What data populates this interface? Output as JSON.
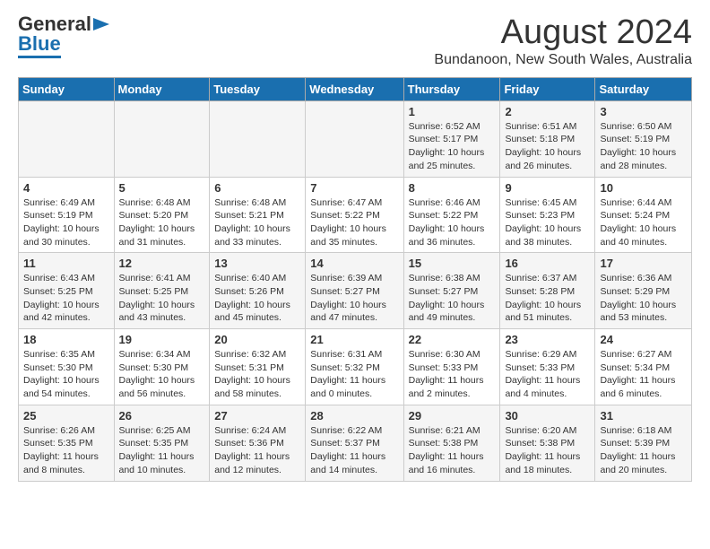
{
  "logo": {
    "general": "General",
    "blue": "Blue"
  },
  "header": {
    "month": "August 2024",
    "location": "Bundanoon, New South Wales, Australia"
  },
  "weekdays": [
    "Sunday",
    "Monday",
    "Tuesday",
    "Wednesday",
    "Thursday",
    "Friday",
    "Saturday"
  ],
  "weeks": [
    [
      {
        "day": "",
        "info": ""
      },
      {
        "day": "",
        "info": ""
      },
      {
        "day": "",
        "info": ""
      },
      {
        "day": "",
        "info": ""
      },
      {
        "day": "1",
        "info": "Sunrise: 6:52 AM\nSunset: 5:17 PM\nDaylight: 10 hours\nand 25 minutes."
      },
      {
        "day": "2",
        "info": "Sunrise: 6:51 AM\nSunset: 5:18 PM\nDaylight: 10 hours\nand 26 minutes."
      },
      {
        "day": "3",
        "info": "Sunrise: 6:50 AM\nSunset: 5:19 PM\nDaylight: 10 hours\nand 28 minutes."
      }
    ],
    [
      {
        "day": "4",
        "info": "Sunrise: 6:49 AM\nSunset: 5:19 PM\nDaylight: 10 hours\nand 30 minutes."
      },
      {
        "day": "5",
        "info": "Sunrise: 6:48 AM\nSunset: 5:20 PM\nDaylight: 10 hours\nand 31 minutes."
      },
      {
        "day": "6",
        "info": "Sunrise: 6:48 AM\nSunset: 5:21 PM\nDaylight: 10 hours\nand 33 minutes."
      },
      {
        "day": "7",
        "info": "Sunrise: 6:47 AM\nSunset: 5:22 PM\nDaylight: 10 hours\nand 35 minutes."
      },
      {
        "day": "8",
        "info": "Sunrise: 6:46 AM\nSunset: 5:22 PM\nDaylight: 10 hours\nand 36 minutes."
      },
      {
        "day": "9",
        "info": "Sunrise: 6:45 AM\nSunset: 5:23 PM\nDaylight: 10 hours\nand 38 minutes."
      },
      {
        "day": "10",
        "info": "Sunrise: 6:44 AM\nSunset: 5:24 PM\nDaylight: 10 hours\nand 40 minutes."
      }
    ],
    [
      {
        "day": "11",
        "info": "Sunrise: 6:43 AM\nSunset: 5:25 PM\nDaylight: 10 hours\nand 42 minutes."
      },
      {
        "day": "12",
        "info": "Sunrise: 6:41 AM\nSunset: 5:25 PM\nDaylight: 10 hours\nand 43 minutes."
      },
      {
        "day": "13",
        "info": "Sunrise: 6:40 AM\nSunset: 5:26 PM\nDaylight: 10 hours\nand 45 minutes."
      },
      {
        "day": "14",
        "info": "Sunrise: 6:39 AM\nSunset: 5:27 PM\nDaylight: 10 hours\nand 47 minutes."
      },
      {
        "day": "15",
        "info": "Sunrise: 6:38 AM\nSunset: 5:27 PM\nDaylight: 10 hours\nand 49 minutes."
      },
      {
        "day": "16",
        "info": "Sunrise: 6:37 AM\nSunset: 5:28 PM\nDaylight: 10 hours\nand 51 minutes."
      },
      {
        "day": "17",
        "info": "Sunrise: 6:36 AM\nSunset: 5:29 PM\nDaylight: 10 hours\nand 53 minutes."
      }
    ],
    [
      {
        "day": "18",
        "info": "Sunrise: 6:35 AM\nSunset: 5:30 PM\nDaylight: 10 hours\nand 54 minutes."
      },
      {
        "day": "19",
        "info": "Sunrise: 6:34 AM\nSunset: 5:30 PM\nDaylight: 10 hours\nand 56 minutes."
      },
      {
        "day": "20",
        "info": "Sunrise: 6:32 AM\nSunset: 5:31 PM\nDaylight: 10 hours\nand 58 minutes."
      },
      {
        "day": "21",
        "info": "Sunrise: 6:31 AM\nSunset: 5:32 PM\nDaylight: 11 hours\nand 0 minutes."
      },
      {
        "day": "22",
        "info": "Sunrise: 6:30 AM\nSunset: 5:33 PM\nDaylight: 11 hours\nand 2 minutes."
      },
      {
        "day": "23",
        "info": "Sunrise: 6:29 AM\nSunset: 5:33 PM\nDaylight: 11 hours\nand 4 minutes."
      },
      {
        "day": "24",
        "info": "Sunrise: 6:27 AM\nSunset: 5:34 PM\nDaylight: 11 hours\nand 6 minutes."
      }
    ],
    [
      {
        "day": "25",
        "info": "Sunrise: 6:26 AM\nSunset: 5:35 PM\nDaylight: 11 hours\nand 8 minutes."
      },
      {
        "day": "26",
        "info": "Sunrise: 6:25 AM\nSunset: 5:35 PM\nDaylight: 11 hours\nand 10 minutes."
      },
      {
        "day": "27",
        "info": "Sunrise: 6:24 AM\nSunset: 5:36 PM\nDaylight: 11 hours\nand 12 minutes."
      },
      {
        "day": "28",
        "info": "Sunrise: 6:22 AM\nSunset: 5:37 PM\nDaylight: 11 hours\nand 14 minutes."
      },
      {
        "day": "29",
        "info": "Sunrise: 6:21 AM\nSunset: 5:38 PM\nDaylight: 11 hours\nand 16 minutes."
      },
      {
        "day": "30",
        "info": "Sunrise: 6:20 AM\nSunset: 5:38 PM\nDaylight: 11 hours\nand 18 minutes."
      },
      {
        "day": "31",
        "info": "Sunrise: 6:18 AM\nSunset: 5:39 PM\nDaylight: 11 hours\nand 20 minutes."
      }
    ]
  ]
}
